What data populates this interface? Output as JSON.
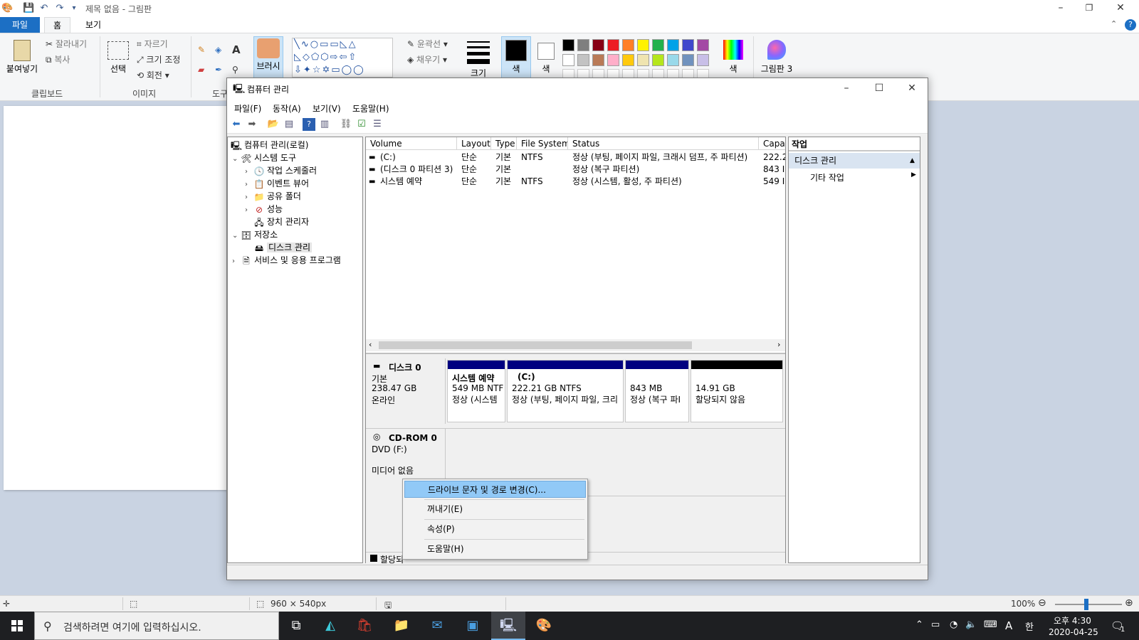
{
  "paint": {
    "title": "제목 없음 - 그림판",
    "tabs": [
      "파일",
      "홈",
      "보기"
    ],
    "clipboard": {
      "paste": "붙여넣기",
      "cut": "잘라내기",
      "copy": "복사",
      "group": "클립보드"
    },
    "image": {
      "select": "선택",
      "crop": "자르기",
      "resize": "크기 조정",
      "rotate": "회전",
      "group": "이미지"
    },
    "tools": {
      "group": "도구"
    },
    "brush": "브러시",
    "shapes": {
      "outline": "윤곽선",
      "fill": "채우기"
    },
    "size": "크기",
    "color1": "색",
    "color2": "색",
    "edit_colors": "색",
    "paint3d": "그림판 3",
    "palette_row1": [
      "#000000",
      "#7f7f7f",
      "#880015",
      "#ed1c24",
      "#ff7f27",
      "#fff200",
      "#22b14c",
      "#00a2e8",
      "#3f48cc",
      "#a349a4"
    ],
    "palette_row2": [
      "#ffffff",
      "#c3c3c3",
      "#b97a57",
      "#ffaec9",
      "#ffc90e",
      "#efe4b0",
      "#b5e61d",
      "#99d9ea",
      "#7092be",
      "#c8bfe7"
    ],
    "status": {
      "dimensions": "960 × 540px",
      "zoom": "100%"
    }
  },
  "cm": {
    "title": "컴퓨터 관리",
    "menu": [
      "파일(F)",
      "동작(A)",
      "보기(V)",
      "도움말(H)"
    ],
    "tree": [
      {
        "label": "컴퓨터 관리(로컬)",
        "level": 0
      },
      {
        "label": "시스템 도구",
        "level": 1
      },
      {
        "label": "작업 스케줄러",
        "level": 2
      },
      {
        "label": "이벤트 뷰어",
        "level": 2
      },
      {
        "label": "공유 폴더",
        "level": 2
      },
      {
        "label": "성능",
        "level": 2
      },
      {
        "label": "장치 관리자",
        "level": 2
      },
      {
        "label": "저장소",
        "level": 1
      },
      {
        "label": "디스크 관리",
        "level": 2
      },
      {
        "label": "서비스 및 응용 프로그램",
        "level": 1
      }
    ],
    "volume_columns": [
      "Volume",
      "Layout",
      "Type",
      "File System",
      "Status",
      "Capa"
    ],
    "volumes": [
      {
        "volume": "(C:)",
        "layout": "단순",
        "type": "기본",
        "fs": "NTFS",
        "status": "정상 (부팅, 페이지 파일, 크래시 덤프, 주 파티션)",
        "cap": "222.2"
      },
      {
        "volume": "(디스크 0 파티션 3)",
        "layout": "단순",
        "type": "기본",
        "fs": "",
        "status": "정상 (복구 파티션)",
        "cap": "843 I"
      },
      {
        "volume": "시스템 예약",
        "layout": "단순",
        "type": "기본",
        "fs": "NTFS",
        "status": "정상 (시스템, 활성, 주 파티션)",
        "cap": "549 I"
      }
    ],
    "disk0": {
      "name": "디스크 0",
      "type": "기본",
      "size": "238.47 GB",
      "state": "온라인",
      "partitions": [
        {
          "name": "시스템 예약",
          "size": "549 MB NTF",
          "status": "정상 (시스템"
        },
        {
          "name": "(C:)",
          "size": "222.21 GB NTFS",
          "status": "정상 (부팅, 페이지 파일, 크리"
        },
        {
          "name": "",
          "size": "843 MB",
          "status": "정상 (복구 파I"
        },
        {
          "name": "",
          "size": "14.91 GB",
          "status": "할당되지 않음"
        }
      ]
    },
    "cdrom": {
      "name": "CD-ROM 0",
      "drive": "DVD (F:)",
      "media": "미디어 없음"
    },
    "legend": "할당되",
    "actions": {
      "header": "작업",
      "section": "디스크 관리",
      "more": "기타 작업"
    }
  },
  "context_menu": [
    "드라이브 문자 및 경로 변경(C)...",
    "꺼내기(E)",
    "속성(P)",
    "도움말(H)"
  ],
  "taskbar": {
    "search_placeholder": "검색하려면 여기에 입력하십시오.",
    "time": "오후 4:30",
    "date": "2020-04-25",
    "ime_lang": "A",
    "ime_mode": "한",
    "notifications": "1"
  }
}
